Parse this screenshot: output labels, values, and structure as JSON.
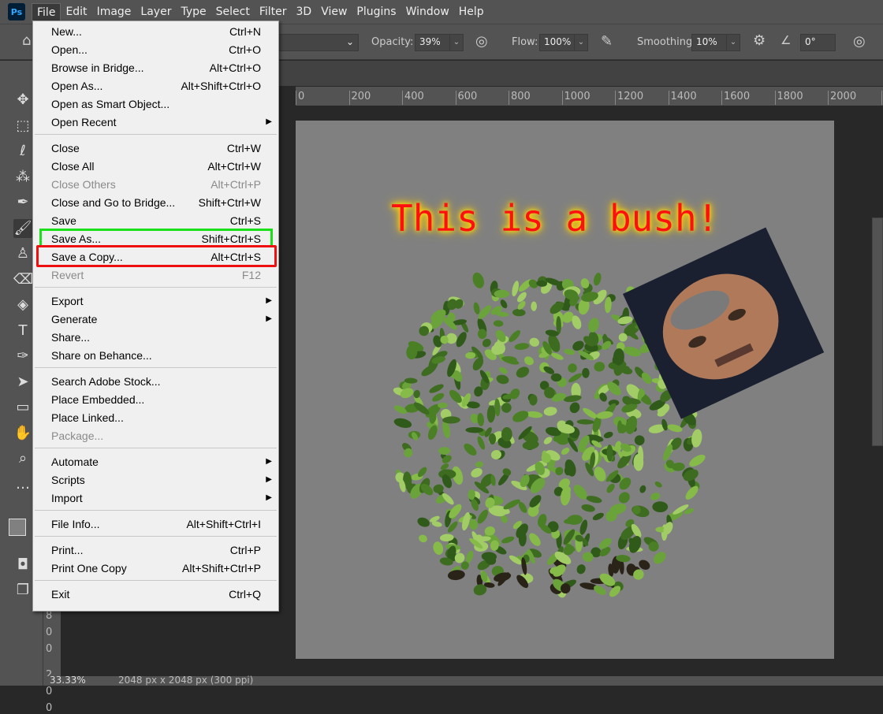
{
  "app": {
    "logo": "Ps"
  },
  "menubar": [
    "File",
    "Edit",
    "Image",
    "Layer",
    "Type",
    "Select",
    "Filter",
    "3D",
    "View",
    "Plugins",
    "Window",
    "Help"
  ],
  "options": {
    "opacity_label": "Opacity:",
    "opacity": "39%",
    "flow_label": "Flow:",
    "flow": "100%",
    "smoothing_label": "Smoothing:",
    "smoothing": "10%",
    "angle": "0°"
  },
  "ruler_top": [
    "0",
    "200",
    "400",
    "600",
    "800",
    "1000",
    "1200",
    "1400",
    "1600",
    "1800",
    "2000",
    "22"
  ],
  "ruler_left": [
    "8",
    "0",
    "0",
    "2",
    "0",
    "0"
  ],
  "canvas": {
    "text": "This is a bush!",
    "text_color": "#ff1010",
    "glow_color": "#ffe000",
    "background": "#808080"
  },
  "status": {
    "zoom": "33.33%",
    "doc": "2048 px x 2048 px (300 ppi)"
  },
  "file_menu": [
    [
      {
        "label": "New...",
        "sc": "Ctrl+N"
      },
      {
        "label": "Open...",
        "sc": "Ctrl+O"
      },
      {
        "label": "Browse in Bridge...",
        "sc": "Alt+Ctrl+O"
      },
      {
        "label": "Open As...",
        "sc": "Alt+Shift+Ctrl+O"
      },
      {
        "label": "Open as Smart Object...",
        "sc": ""
      },
      {
        "label": "Open Recent",
        "sc": "",
        "sub": true
      }
    ],
    [
      {
        "label": "Close",
        "sc": "Ctrl+W"
      },
      {
        "label": "Close All",
        "sc": "Alt+Ctrl+W"
      },
      {
        "label": "Close Others",
        "sc": "Alt+Ctrl+P",
        "disabled": true
      },
      {
        "label": "Close and Go to Bridge...",
        "sc": "Shift+Ctrl+W"
      },
      {
        "label": "Save",
        "sc": "Ctrl+S"
      },
      {
        "label": "Save As...",
        "sc": "Shift+Ctrl+S"
      },
      {
        "label": "Save a Copy...",
        "sc": "Alt+Ctrl+S"
      },
      {
        "label": "Revert",
        "sc": "F12",
        "disabled": true
      }
    ],
    [
      {
        "label": "Export",
        "sc": "",
        "sub": true
      },
      {
        "label": "Generate",
        "sc": "",
        "sub": true
      },
      {
        "label": "Share...",
        "sc": ""
      },
      {
        "label": "Share on Behance...",
        "sc": ""
      }
    ],
    [
      {
        "label": "Search Adobe Stock...",
        "sc": ""
      },
      {
        "label": "Place Embedded...",
        "sc": ""
      },
      {
        "label": "Place Linked...",
        "sc": ""
      },
      {
        "label": "Package...",
        "sc": "",
        "disabled": true
      }
    ],
    [
      {
        "label": "Automate",
        "sc": "",
        "sub": true
      },
      {
        "label": "Scripts",
        "sc": "",
        "sub": true
      },
      {
        "label": "Import",
        "sc": "",
        "sub": true
      }
    ],
    [
      {
        "label": "File Info...",
        "sc": "Alt+Shift+Ctrl+I"
      }
    ],
    [
      {
        "label": "Print...",
        "sc": "Ctrl+P"
      },
      {
        "label": "Print One Copy",
        "sc": "Alt+Shift+Ctrl+P"
      }
    ],
    [
      {
        "label": "Exit",
        "sc": "Ctrl+Q"
      }
    ]
  ],
  "highlights": {
    "save_as": "#19e019",
    "save_a_copy": "#ee1010"
  }
}
